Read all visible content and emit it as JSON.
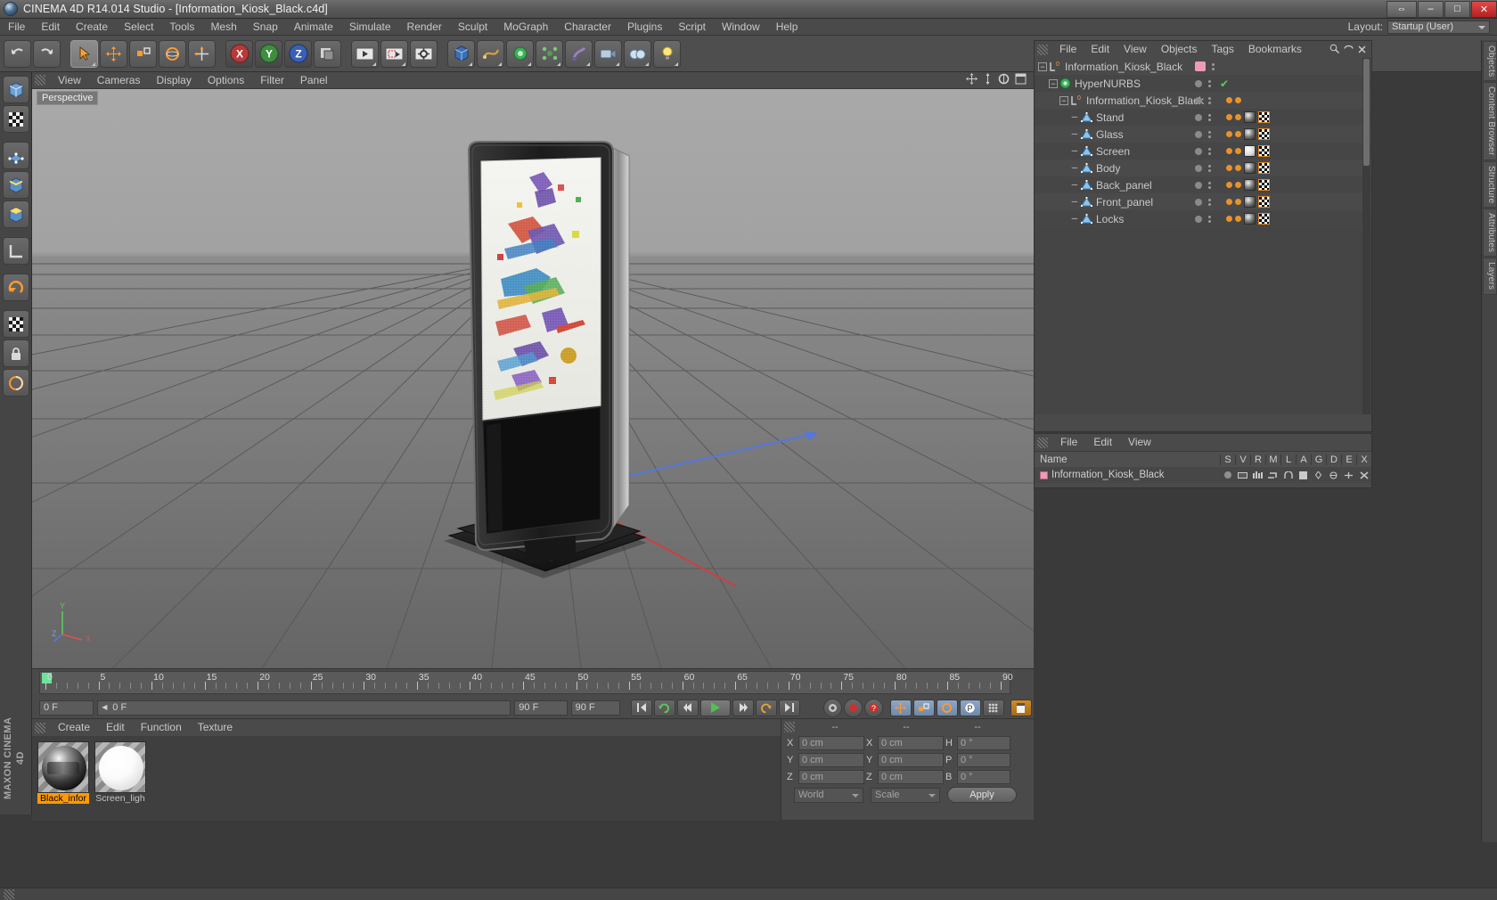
{
  "window": {
    "title": "CINEMA 4D R14.014 Studio - [Information_Kiosk_Black.c4d]",
    "app_icon": "c4d-logo-icon",
    "buttons": {
      "restore_all": "⇔",
      "minimize": "–",
      "maximize": "□",
      "close": "✕"
    }
  },
  "menu": {
    "items": [
      "File",
      "Edit",
      "Create",
      "Select",
      "Tools",
      "Mesh",
      "Snap",
      "Animate",
      "Simulate",
      "Render",
      "Sculpt",
      "MoGraph",
      "Character",
      "Plugins",
      "Script",
      "Window",
      "Help"
    ],
    "layout_label": "Layout:",
    "layout_value": "Startup (User)"
  },
  "toolbar": {
    "buttons": [
      {
        "name": "undo-button",
        "icon": "undo-arrow-icon"
      },
      {
        "name": "redo-button",
        "icon": "redo-arrow-icon"
      },
      {
        "name": "live-selection-button",
        "icon": "cursor-select-icon"
      },
      {
        "name": "move-button",
        "icon": "move-arrows-icon"
      },
      {
        "name": "scale-button",
        "icon": "scale-box-icon"
      },
      {
        "name": "rotate-button",
        "icon": "rotate-circle-icon"
      },
      {
        "name": "world-axis-button",
        "icon": "axis-move-icon"
      },
      {
        "name": "x-axis-lock-button",
        "icon": "x-axis-icon",
        "label": "X"
      },
      {
        "name": "y-axis-lock-button",
        "icon": "y-axis-icon",
        "label": "Y"
      },
      {
        "name": "z-axis-lock-button",
        "icon": "z-axis-icon",
        "label": "Z"
      },
      {
        "name": "world-object-coords-button",
        "icon": "world-coord-icon"
      },
      {
        "name": "render-view-button",
        "icon": "render-view-icon"
      },
      {
        "name": "render-region-button",
        "icon": "render-region-icon"
      },
      {
        "name": "render-settings-button",
        "icon": "render-settings-icon"
      },
      {
        "name": "add-cube-button",
        "icon": "cube-icon"
      },
      {
        "name": "add-spline-button",
        "icon": "spline-pen-icon"
      },
      {
        "name": "add-nurbs-button",
        "icon": "hypernurbs-icon"
      },
      {
        "name": "add-array-button",
        "icon": "array-icon"
      },
      {
        "name": "add-deformer-button",
        "icon": "bend-deformer-icon"
      },
      {
        "name": "add-camera-button",
        "icon": "camera-icon"
      },
      {
        "name": "add-floor-button",
        "icon": "floor-environment-icon"
      },
      {
        "name": "add-light-button",
        "icon": "light-bulb-icon"
      }
    ]
  },
  "left_tools": [
    {
      "name": "model-mode-button",
      "icon": "model-cube-icon"
    },
    {
      "name": "texture-mode-button",
      "icon": "texture-checker-icon"
    },
    {
      "name": "points-mode-button",
      "icon": "points-mesh-icon"
    },
    {
      "name": "edges-mode-button",
      "icon": "edges-cube-icon"
    },
    {
      "name": "polygons-mode-button",
      "icon": "polygon-cube-icon"
    },
    {
      "name": "workplane-button",
      "icon": "workplane-axis-icon"
    },
    {
      "name": "enable-axis-button",
      "icon": "axis-rotate-icon"
    },
    {
      "name": "viewport-solo-button",
      "icon": "checker-solo-icon"
    },
    {
      "name": "lock-axis-button",
      "icon": "padlock-icon"
    },
    {
      "name": "soft-selection-button",
      "icon": "soft-select-icon"
    }
  ],
  "brand": "MAXON CINEMA 4D",
  "viewport": {
    "menu": [
      "View",
      "Cameras",
      "Display",
      "Options",
      "Filter",
      "Panel"
    ],
    "badge": "Perspective",
    "nav_icons": [
      "pan-icon",
      "dolly-icon",
      "orbit-icon",
      "maximize-view-icon"
    ],
    "axis": {
      "y": "Y",
      "x": "X",
      "z": "Z"
    },
    "object_label": "Information_Kiosk_Black"
  },
  "timeline": {
    "start_frame": "0 F",
    "current_frame_field": "0 F",
    "end_frame": "90 F",
    "preview_end": "90 F",
    "ticks": [
      0,
      5,
      10,
      15,
      20,
      25,
      30,
      35,
      40,
      45,
      50,
      55,
      60,
      65,
      70,
      75,
      80,
      85,
      90
    ],
    "frame_field_right": "0 F",
    "transport": [
      {
        "name": "go-to-start-button",
        "icon": "skip-back-icon"
      },
      {
        "name": "play-backwards-button",
        "icon": "loop-icon"
      },
      {
        "name": "previous-frame-button",
        "icon": "step-back-icon"
      },
      {
        "name": "play-button",
        "icon": "play-icon"
      },
      {
        "name": "next-frame-button",
        "icon": "step-forward-icon"
      },
      {
        "name": "play-forward-loop-button",
        "icon": "loop-forward-icon"
      },
      {
        "name": "go-to-end-button",
        "icon": "skip-forward-icon"
      }
    ],
    "record_tools": [
      {
        "name": "record-active-objects-button",
        "icon": "record-key-icon"
      },
      {
        "name": "autokeying-button",
        "icon": "red-record-icon"
      },
      {
        "name": "keyframe-selection-button",
        "icon": "question-key-icon"
      },
      {
        "name": "position-key-button",
        "icon": "move-key-icon"
      },
      {
        "name": "scale-key-button",
        "icon": "scale-key-icon"
      },
      {
        "name": "rotation-key-button",
        "icon": "rotate-key-icon"
      },
      {
        "name": "parameter-key-button",
        "icon": "param-key-icon"
      },
      {
        "name": "point-level-animation-button",
        "icon": "pla-icon"
      },
      {
        "name": "timeline-settings-button",
        "icon": "timeline-icon"
      }
    ]
  },
  "material_manager": {
    "menu": [
      "Create",
      "Edit",
      "Function",
      "Texture"
    ],
    "materials": [
      {
        "name": "Black_infor",
        "selected": true,
        "icon": "material-sphere-chrome"
      },
      {
        "name": "Screen_ligh",
        "selected": false,
        "icon": "material-sphere-white"
      }
    ]
  },
  "coordinates": {
    "headers": [
      "--",
      "--",
      "--"
    ],
    "rows": [
      {
        "label1": "X",
        "value1": "0 cm",
        "label2": "X",
        "value2": "0 cm",
        "label3": "H",
        "value3": "0 °"
      },
      {
        "label1": "Y",
        "value1": "0 cm",
        "label2": "Y",
        "value2": "0 cm",
        "label3": "P",
        "value3": "0 °"
      },
      {
        "label1": "Z",
        "value1": "0 cm",
        "label2": "Z",
        "value2": "0 cm",
        "label3": "B",
        "value3": "0 °"
      }
    ],
    "system_dropdown": "World",
    "mode_dropdown": "Scale",
    "apply_button": "Apply"
  },
  "object_manager": {
    "menu": [
      "File",
      "Edit",
      "View",
      "Objects",
      "Tags",
      "Bookmarks"
    ],
    "search_icons": [
      "search-icon",
      "sort-icon",
      "close-icon"
    ],
    "objects": [
      {
        "name": "Information_Kiosk_Black",
        "indent": 0,
        "icon": "null-object-icon",
        "expander": "−",
        "swatch": "pink",
        "dots": true,
        "tags": []
      },
      {
        "name": "HyperNURBS",
        "indent": 1,
        "icon": "hypernurbs-green-icon",
        "expander": "−",
        "check": true,
        "dots": true,
        "tags": []
      },
      {
        "name": "Information_Kiosk_Black",
        "indent": 2,
        "icon": "null-object-icon",
        "expander": "−",
        "dots": true,
        "tags": [
          "dot",
          "dot"
        ]
      },
      {
        "name": "Stand",
        "indent": 3,
        "icon": "polygon-object-icon",
        "dots": true,
        "tags": [
          "dot",
          "dot",
          "mat",
          "uv"
        ]
      },
      {
        "name": "Glass",
        "indent": 3,
        "icon": "polygon-object-icon",
        "dots": true,
        "tags": [
          "dot",
          "dot",
          "mat",
          "uv"
        ]
      },
      {
        "name": "Screen",
        "indent": 3,
        "icon": "polygon-object-icon",
        "dots": true,
        "tags": [
          "dot",
          "dot",
          "matw",
          "uv"
        ]
      },
      {
        "name": "Body",
        "indent": 3,
        "icon": "polygon-object-icon",
        "dots": true,
        "tags": [
          "dot",
          "dot",
          "mat",
          "uv"
        ]
      },
      {
        "name": "Back_panel",
        "indent": 3,
        "icon": "polygon-object-icon",
        "dots": true,
        "tags": [
          "dot",
          "dot",
          "mat",
          "uv"
        ]
      },
      {
        "name": "Front_panel",
        "indent": 3,
        "icon": "polygon-object-icon",
        "dots": true,
        "tags": [
          "dot",
          "dot",
          "mat",
          "uv"
        ]
      },
      {
        "name": "Locks",
        "indent": 3,
        "icon": "polygon-object-icon",
        "dots": true,
        "tags": [
          "dot",
          "dot",
          "mat",
          "uv"
        ]
      }
    ]
  },
  "layer_manager": {
    "menu": [
      "File",
      "Edit",
      "View"
    ],
    "columns": [
      "S",
      "V",
      "R",
      "M",
      "L",
      "A",
      "G",
      "D",
      "E",
      "X"
    ],
    "name_header": "Name",
    "rows": [
      {
        "name": "Information_Kiosk_Black",
        "swatch": "pink"
      }
    ]
  },
  "dock_tabs": [
    "Objects",
    "Content Browser",
    "Structure",
    "Attributes",
    "Layers"
  ],
  "colors": {
    "accent_orange": "#ff9a00",
    "tag_orange": "#e8922a",
    "pink_swatch": "#f09bb6",
    "green_check": "#5ccb5c",
    "panel_bg": "#4a4a4a",
    "window_bg": "#3a3a3a",
    "text": "#c8c8c8"
  }
}
